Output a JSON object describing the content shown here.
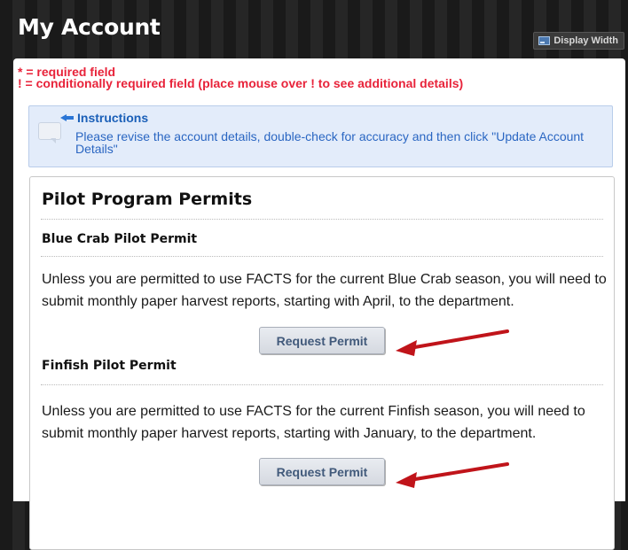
{
  "header": {
    "title": "My Account",
    "display_width_label": "Display Width"
  },
  "legend": {
    "required": "* = required field",
    "conditional": "! = conditionally required field (place mouse over ! to see additional details)"
  },
  "instructions": {
    "title": "Instructions",
    "text": "Please revise the account details, double-check for accuracy and then click \"Update Account Details\""
  },
  "permits": {
    "section_title": "Pilot Program Permits",
    "items": [
      {
        "title": "Blue Crab Pilot Permit",
        "description": "Unless you are permitted to use FACTS for the current Blue Crab season, you will need to submit monthly paper harvest reports, starting with April, to the department.",
        "button_label": "Request Permit"
      },
      {
        "title": "Finfish Pilot Permit",
        "description": "Unless you are permitted to use FACTS for the current Finfish season, you will need to submit monthly paper harvest reports, starting with January, to the department.",
        "button_label": "Request Permit"
      }
    ]
  },
  "colors": {
    "required_text": "#e8233a",
    "instructions_bg": "#e3ecfa",
    "instructions_text": "#2a66c2",
    "annotation_arrow": "#c0141a"
  }
}
